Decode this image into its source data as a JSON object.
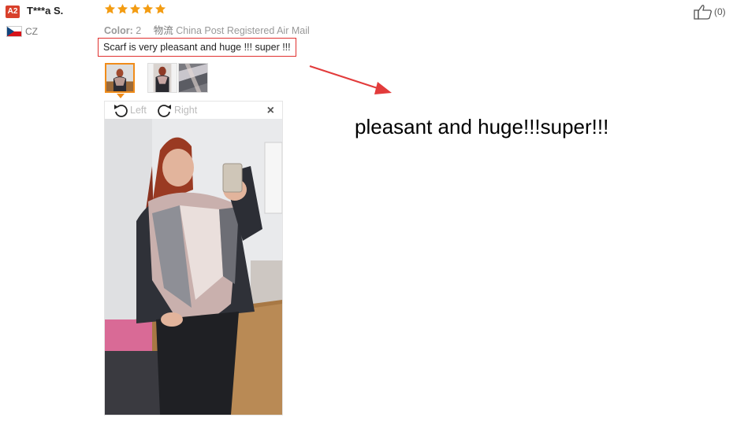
{
  "reviewer": {
    "level_badge": "A2",
    "name": "T***a S.",
    "country": "CZ"
  },
  "rating": {
    "stars": 5,
    "max": 5
  },
  "meta": {
    "color_label": "Color:",
    "color_value": "2",
    "shipping_cn": "物流",
    "shipping_method": "China Post Registered Air Mail"
  },
  "review_text": "Scarf is very pleasant and huge !!! super !!!",
  "viewer": {
    "rotate_left_label": "Left",
    "rotate_right_label": "Right",
    "close_symbol": "×"
  },
  "helpful": {
    "count": "(0)"
  },
  "annotation": "pleasant and huge!!!super!!!",
  "colors": {
    "star": "#f39c12",
    "badge": "#d8402b",
    "highlight_border": "#e0312f",
    "active_thumb": "#f08c1a",
    "arrow": "#e23b3b"
  }
}
